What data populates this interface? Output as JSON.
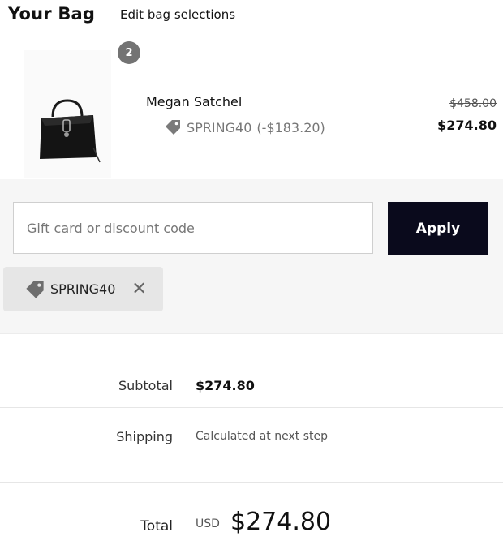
{
  "header": {
    "title": "Your Bag",
    "edit_link": "Edit bag selections"
  },
  "item": {
    "quantity": "2",
    "name": "Megan Satchel",
    "promo_code": "SPRING40",
    "promo_discount": "(-$183.20)",
    "original_price": "$458.00",
    "sale_price": "$274.80",
    "image_icon": "black-handbag"
  },
  "discount": {
    "input_placeholder": "Gift card or discount code",
    "input_value": "",
    "apply_label": "Apply",
    "applied_code": "SPRING40",
    "remove_icon": "close-icon"
  },
  "summary": {
    "subtotal_label": "Subtotal",
    "subtotal_value": "$274.80",
    "shipping_label": "Shipping",
    "shipping_value": "Calculated at next step",
    "total_label": "Total",
    "currency": "USD",
    "total_value": "$274.80"
  },
  "colors": {
    "apply_bg": "#0a0a1c",
    "badge_bg": "#737373",
    "panel_bg": "#f6f6f6",
    "chip_bg": "#e6e6e6"
  }
}
